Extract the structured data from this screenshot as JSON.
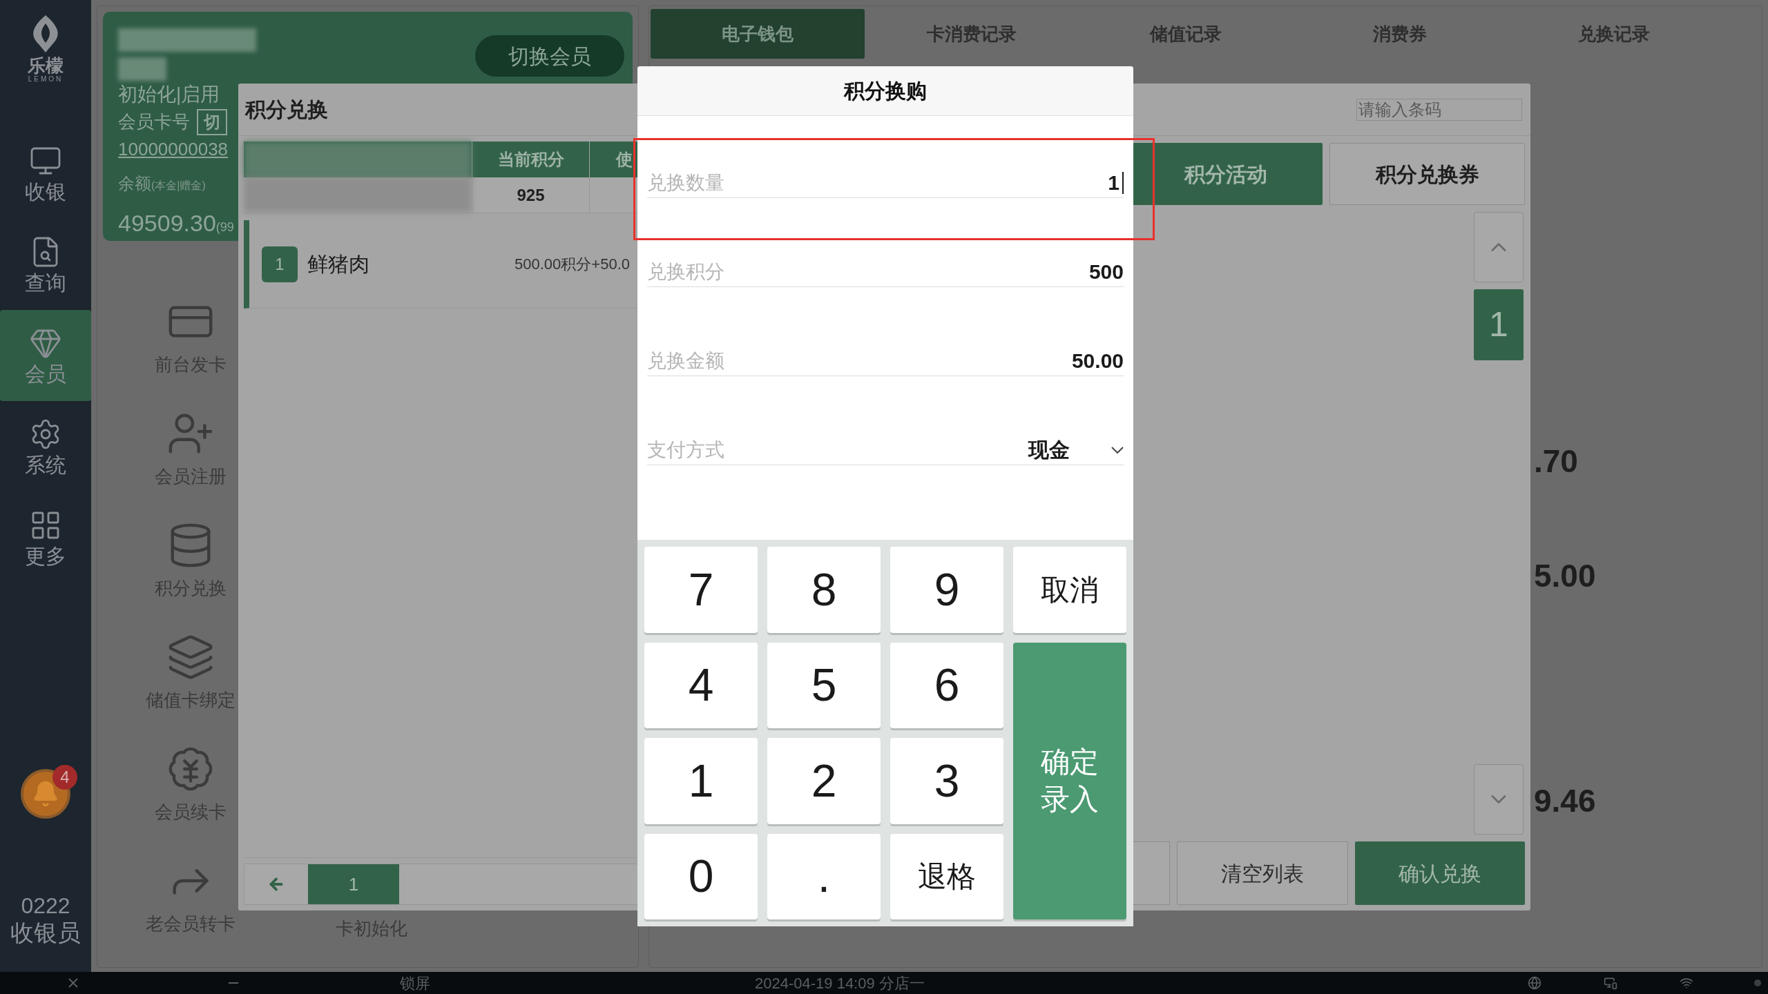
{
  "sidebar": {
    "logo": {
      "name": "乐檬",
      "sub": "LEMON"
    },
    "items": [
      {
        "label": "收银",
        "kind": "cashier",
        "selected": false
      },
      {
        "label": "查询",
        "kind": "query",
        "selected": false
      },
      {
        "label": "会员",
        "kind": "member",
        "selected": true
      },
      {
        "label": "系统",
        "kind": "system",
        "selected": false
      },
      {
        "label": "更多",
        "kind": "more",
        "selected": false
      }
    ],
    "notifications": {
      "count": "4"
    },
    "user": {
      "id": "0222",
      "role": "收银员"
    }
  },
  "member_card": {
    "switch_button": "切换会员",
    "status": "初始化|启用",
    "card_no_label": "会员卡号",
    "card_no_button": "切",
    "card_no": "10000000038",
    "balance_label": "余额",
    "balance_note": "(本金|赠金)",
    "balance": "49509.30",
    "balance_extra": "(99"
  },
  "functions": [
    {
      "label": "前台发卡",
      "kind": "card"
    },
    {
      "label": "会员注册",
      "kind": "register"
    },
    {
      "label": "积分兑换",
      "kind": "points"
    },
    {
      "label": "储值卡绑定",
      "kind": "bind"
    },
    {
      "label": "会员续卡",
      "kind": "renew"
    },
    {
      "label": "老会员转卡",
      "kind": "transfer"
    }
  ],
  "functions_second_column": [
    {
      "label": "卡初始化"
    }
  ],
  "tabs": [
    {
      "label": "电子钱包",
      "selected": true
    },
    {
      "label": "卡消费记录",
      "selected": false
    },
    {
      "label": "储值记录",
      "selected": false
    },
    {
      "label": "消费券",
      "selected": false
    },
    {
      "label": "兑换记录",
      "selected": false
    }
  ],
  "summary_values": [
    ".70",
    "5.00",
    "9.46"
  ],
  "points_panel": {
    "title": "积分兑换",
    "barcode": {
      "placeholder": "请输入条码"
    },
    "table": {
      "columns": [
        "当前积分",
        "使"
      ],
      "row": [
        "925"
      ]
    },
    "items": [
      {
        "index": "1",
        "name": "鲜猪肉",
        "price": "500.00积分+50.0",
        "selected": true
      }
    ],
    "page": "1",
    "categories": [
      {
        "label": "积分活动",
        "selected": true
      },
      {
        "label": "积分兑换券",
        "selected": false
      }
    ],
    "list_page": "1",
    "buttons": [
      {
        "label": "清空列表",
        "kind": "secondary"
      },
      {
        "label": "确认兑换",
        "kind": "primary"
      }
    ]
  },
  "dialog": {
    "title": "积分换购",
    "fields": [
      {
        "label": "兑换数量",
        "value": "1",
        "kind": "input",
        "highlighted": true
      },
      {
        "label": "兑换积分",
        "value": "500",
        "kind": "text",
        "highlighted": false
      },
      {
        "label": "兑换金额",
        "value": "50.00",
        "kind": "text",
        "highlighted": false
      },
      {
        "label": "支付方式",
        "value": "现金",
        "kind": "select",
        "highlighted": false
      }
    ],
    "keypad": [
      {
        "label": "7",
        "kind": "digit"
      },
      {
        "label": "8",
        "kind": "digit"
      },
      {
        "label": "9",
        "kind": "digit"
      },
      {
        "label": "取消",
        "kind": "action"
      },
      {
        "label": "4",
        "kind": "digit"
      },
      {
        "label": "5",
        "kind": "digit"
      },
      {
        "label": "6",
        "kind": "digit"
      },
      {
        "label": "1",
        "kind": "digit"
      },
      {
        "label": "2",
        "kind": "digit"
      },
      {
        "label": "3",
        "kind": "digit"
      },
      {
        "label": "确定录入",
        "kind": "confirm"
      },
      {
        "label": "0",
        "kind": "digit"
      },
      {
        "label": ".",
        "kind": "digit"
      },
      {
        "label": "退格",
        "kind": "action"
      }
    ]
  },
  "taskbar": {
    "lock": "锁屏",
    "status": "2024-04-19 14:09 分店一"
  }
}
